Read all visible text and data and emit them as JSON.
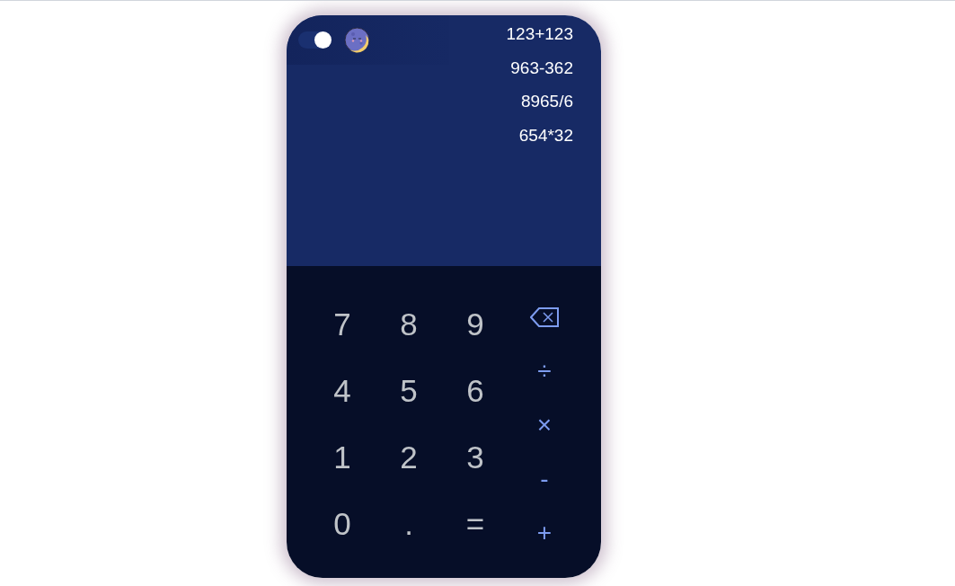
{
  "header": {
    "theme_toggle": {
      "on": true
    }
  },
  "history": [
    "123+123",
    "963-362",
    "8965/6",
    "654*32"
  ],
  "keypad": {
    "digits": [
      [
        "7",
        "8",
        "9"
      ],
      [
        "4",
        "5",
        "6"
      ],
      [
        "1",
        "2",
        "3"
      ],
      [
        "0",
        ".",
        "="
      ]
    ],
    "operators": [
      {
        "kind": "backspace"
      },
      {
        "kind": "text",
        "label": "÷"
      },
      {
        "kind": "text",
        "label": "×"
      },
      {
        "kind": "text",
        "label": "-"
      },
      {
        "kind": "text",
        "label": "+"
      }
    ]
  }
}
